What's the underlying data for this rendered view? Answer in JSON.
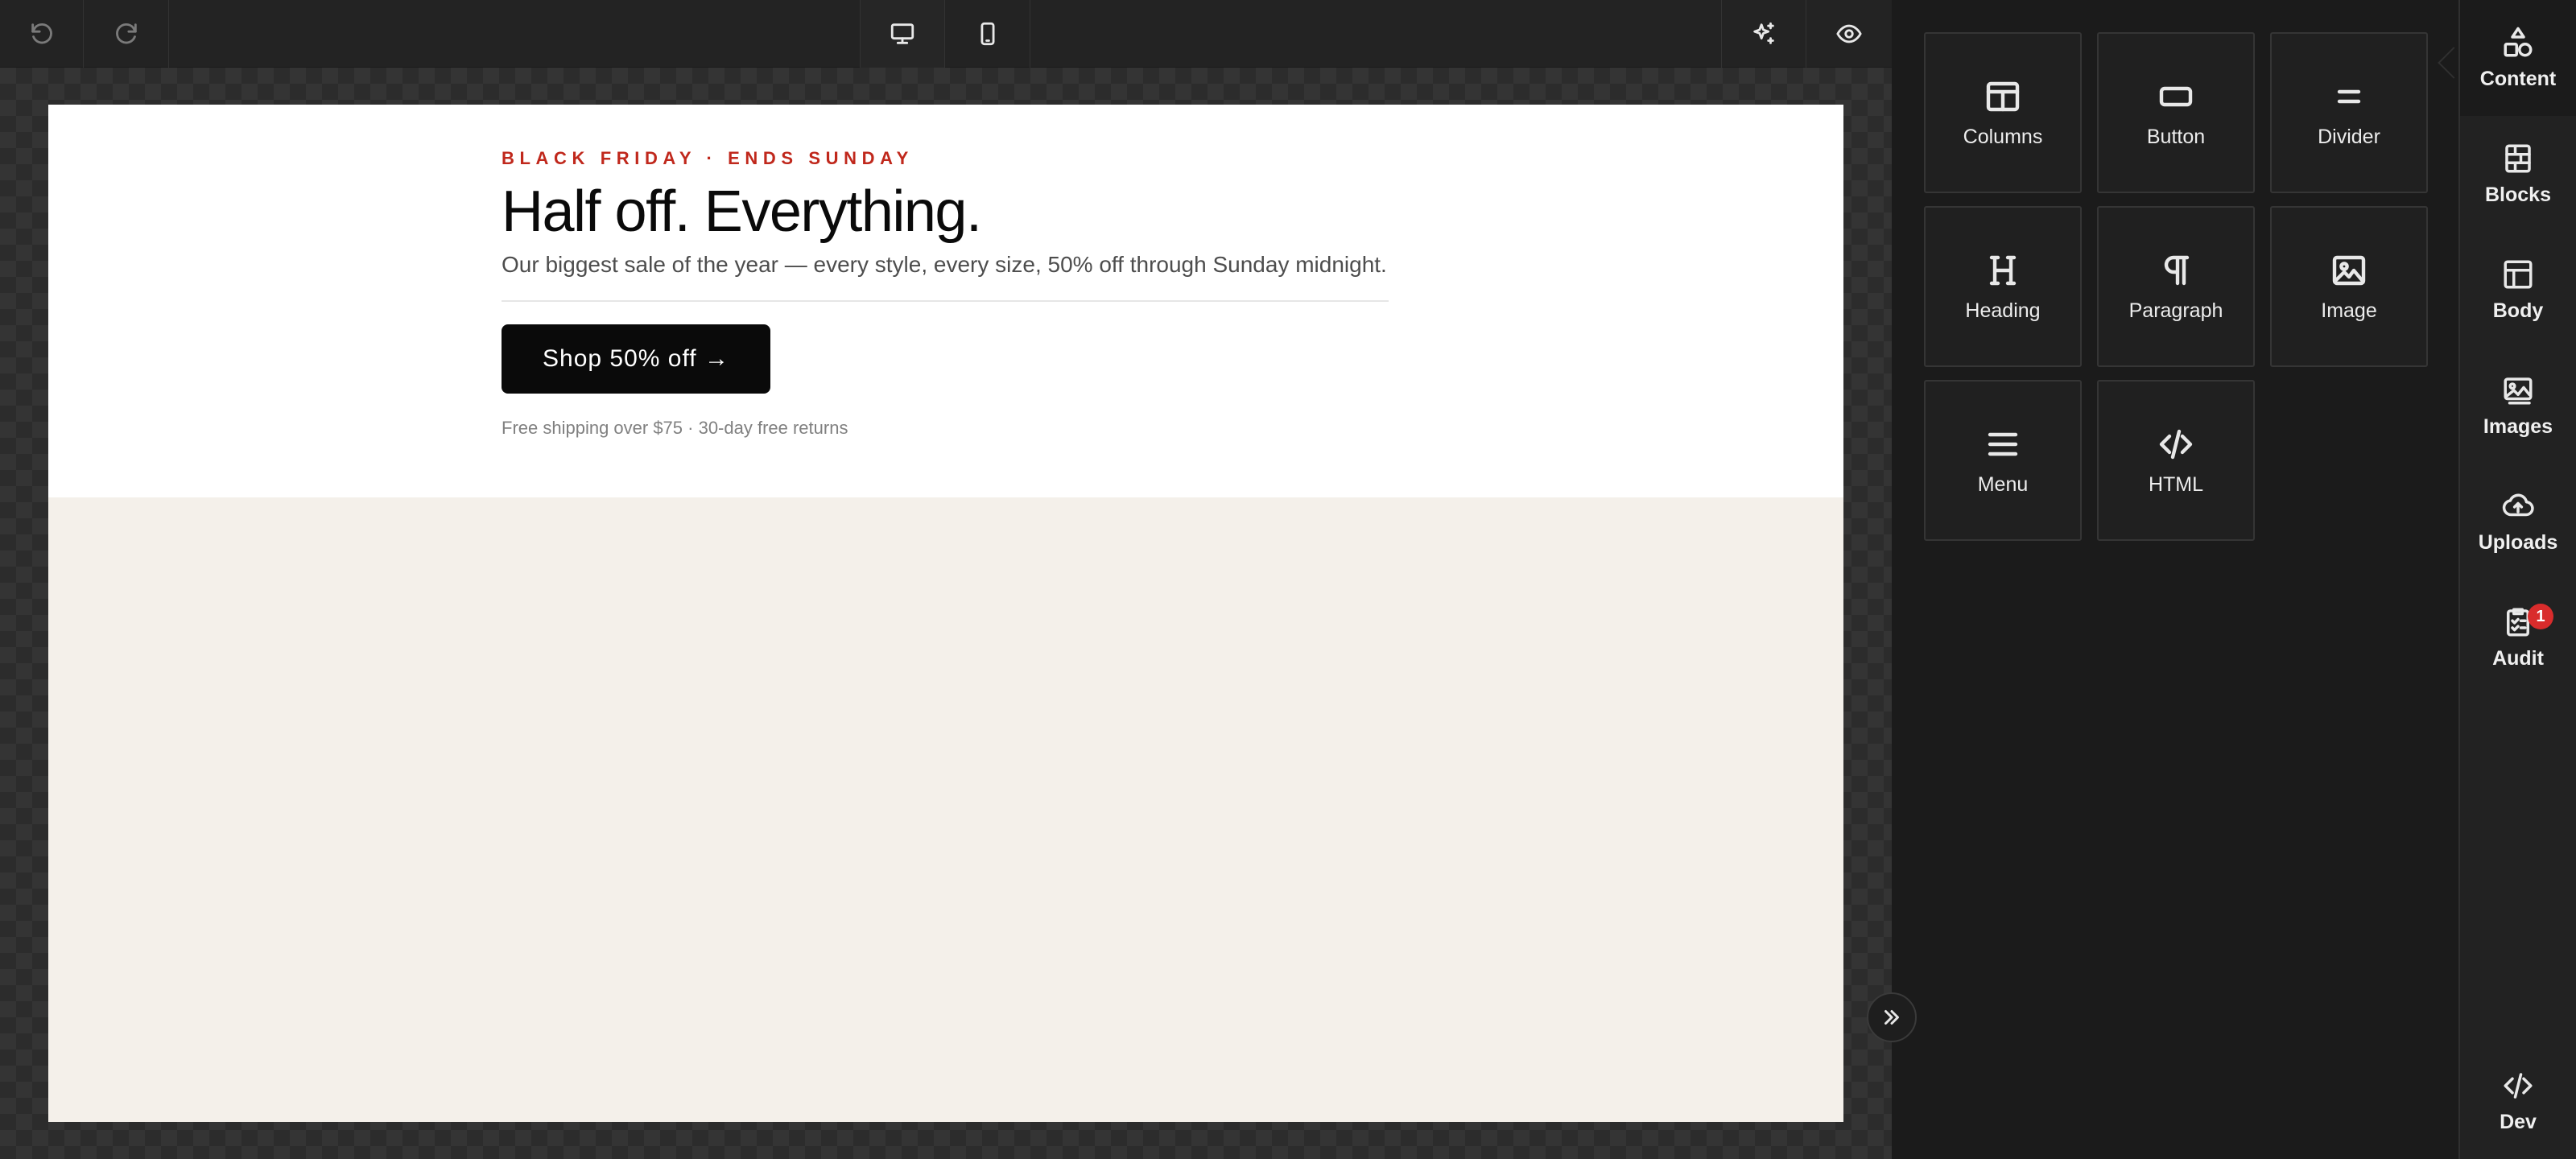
{
  "toolbar": {
    "undo_icon": "undo-icon",
    "redo_icon": "redo-icon",
    "desktop_icon": "desktop-icon",
    "mobile_icon": "mobile-icon",
    "ai_icon": "sparkle-icon",
    "preview_icon": "eye-icon",
    "active_view": "desktop"
  },
  "email": {
    "eyebrow": "BLACK FRIDAY · ENDS SUNDAY",
    "headline": "Half off. Everything.",
    "subline": "Our biggest sale of the year — every style, every size, 50% off through Sunday midnight.",
    "cta_label": "Shop 50% off →",
    "fineprint": "Free shipping over $75 · 30-day free returns",
    "colors": {
      "eyebrow": "#c0281c",
      "cta_bg": "#0a0a0a",
      "body_bg": "#f4f0ea"
    }
  },
  "panel": {
    "tiles": [
      {
        "label": "Columns",
        "icon": "columns-icon"
      },
      {
        "label": "Button",
        "icon": "button-icon"
      },
      {
        "label": "Divider",
        "icon": "divider-icon"
      },
      {
        "label": "Heading",
        "icon": "heading-icon"
      },
      {
        "label": "Paragraph",
        "icon": "paragraph-icon"
      },
      {
        "label": "Image",
        "icon": "image-icon"
      },
      {
        "label": "Menu",
        "icon": "menu-icon"
      },
      {
        "label": "HTML",
        "icon": "code-icon"
      }
    ]
  },
  "nav": {
    "items": [
      {
        "label": "Content",
        "icon": "shapes-icon",
        "active": true
      },
      {
        "label": "Blocks",
        "icon": "blocks-icon"
      },
      {
        "label": "Body",
        "icon": "layout-icon"
      },
      {
        "label": "Images",
        "icon": "images-icon"
      },
      {
        "label": "Uploads",
        "icon": "cloud-upload-icon"
      },
      {
        "label": "Audit",
        "icon": "clipboard-check-icon",
        "badge": "1"
      }
    ],
    "dev": {
      "label": "Dev",
      "icon": "code-icon"
    }
  }
}
